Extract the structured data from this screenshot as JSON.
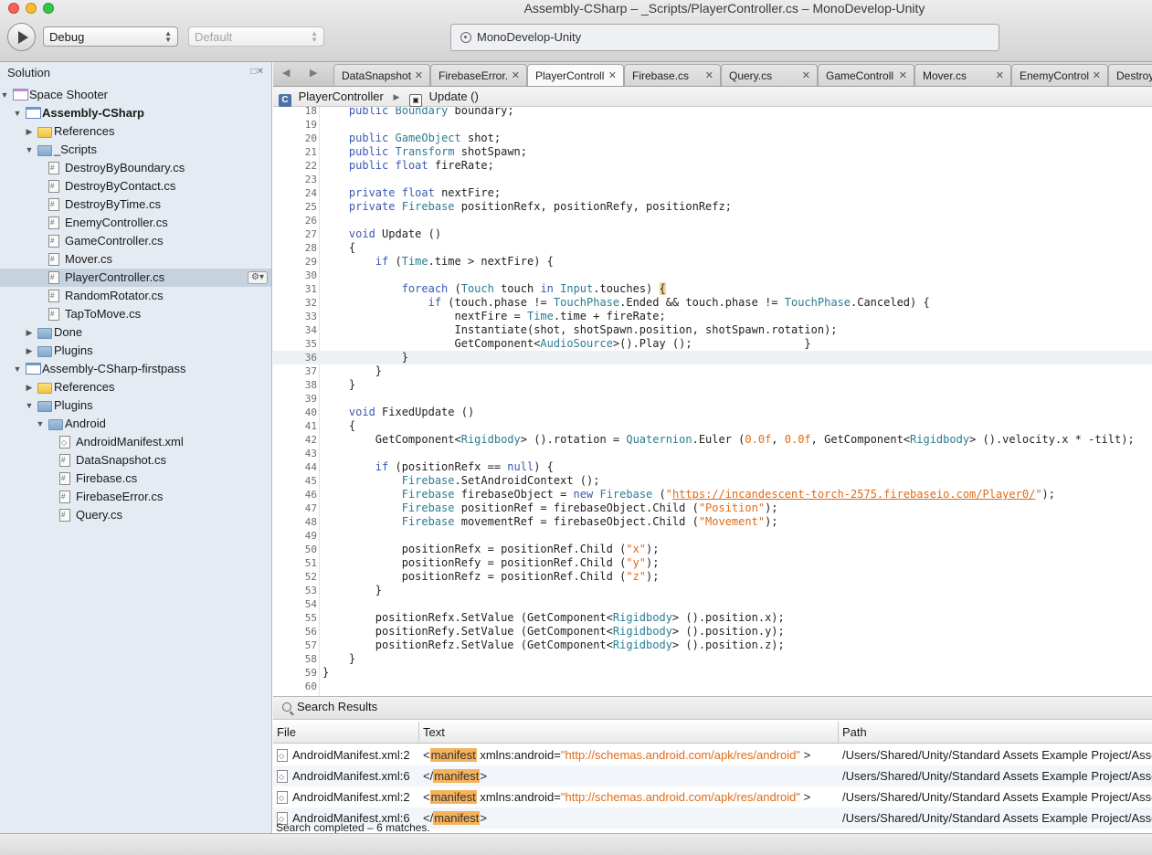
{
  "window": {
    "title": "Assembly-CSharp – _Scripts/PlayerController.cs – MonoDevelop-Unity"
  },
  "toolbar": {
    "config": "Debug",
    "platform": "Default",
    "status": "MonoDevelop-Unity"
  },
  "sidebar": {
    "title": "Solution",
    "items": [
      {
        "label": "Space Shooter",
        "icon": "solution-icon",
        "depth": 0,
        "expander": "down"
      },
      {
        "label": "Assembly-CSharp",
        "icon": "project-icon",
        "depth": 1,
        "expander": "down",
        "bold": true
      },
      {
        "label": "References",
        "icon": "folder-yellow-icon",
        "depth": 2,
        "expander": "right"
      },
      {
        "label": "_Scripts",
        "icon": "folder-icon",
        "depth": 2,
        "expander": "down"
      },
      {
        "label": "DestroyByBoundary.cs",
        "icon": "file-icon",
        "depth": 3
      },
      {
        "label": "DestroyByContact.cs",
        "icon": "file-icon",
        "depth": 3
      },
      {
        "label": "DestroyByTime.cs",
        "icon": "file-icon",
        "depth": 3
      },
      {
        "label": "EnemyController.cs",
        "icon": "file-icon",
        "depth": 3
      },
      {
        "label": "GameController.cs",
        "icon": "file-icon",
        "depth": 3
      },
      {
        "label": "Mover.cs",
        "icon": "file-icon",
        "depth": 3
      },
      {
        "label": "PlayerController.cs",
        "icon": "file-icon",
        "depth": 3,
        "selected": true
      },
      {
        "label": "RandomRotator.cs",
        "icon": "file-icon",
        "depth": 3
      },
      {
        "label": "TapToMove.cs",
        "icon": "file-icon",
        "depth": 3
      },
      {
        "label": "Done",
        "icon": "folder-icon",
        "depth": 2,
        "expander": "right"
      },
      {
        "label": "Plugins",
        "icon": "folder-icon",
        "depth": 2,
        "expander": "right"
      },
      {
        "label": "Assembly-CSharp-firstpass",
        "icon": "project-icon",
        "depth": 1,
        "expander": "down"
      },
      {
        "label": "References",
        "icon": "folder-yellow-icon",
        "depth": 2,
        "expander": "right"
      },
      {
        "label": "Plugins",
        "icon": "folder-icon",
        "depth": 2,
        "expander": "down"
      },
      {
        "label": "Android",
        "icon": "folder-icon",
        "depth": 3,
        "expander": "down"
      },
      {
        "label": "AndroidManifest.xml",
        "icon": "xml-file-icon",
        "depth": 4
      },
      {
        "label": "DataSnapshot.cs",
        "icon": "file-icon",
        "depth": 4
      },
      {
        "label": "Firebase.cs",
        "icon": "file-icon",
        "depth": 4
      },
      {
        "label": "FirebaseError.cs",
        "icon": "file-icon",
        "depth": 4
      },
      {
        "label": "Query.cs",
        "icon": "file-icon",
        "depth": 4
      }
    ]
  },
  "tabs": [
    {
      "label": "DataSnapshot"
    },
    {
      "label": "FirebaseError."
    },
    {
      "label": "PlayerControll",
      "active": true
    },
    {
      "label": "Firebase.cs"
    },
    {
      "label": "Query.cs"
    },
    {
      "label": "GameControll"
    },
    {
      "label": "Mover.cs"
    },
    {
      "label": "EnemyControl"
    },
    {
      "label": "Destroy"
    }
  ],
  "breadcrumb": {
    "class": "PlayerController",
    "method": "Update ()"
  },
  "editor": {
    "current_line": 36,
    "lines": [
      {
        "n": 18,
        "html": "    <span class=\"kw\">public</span> <span class=\"tp\">Boundary</span> boundary;"
      },
      {
        "n": 19,
        "html": ""
      },
      {
        "n": 20,
        "html": "    <span class=\"kw\">public</span> <span class=\"tp\">GameObject</span> shot;"
      },
      {
        "n": 21,
        "html": "    <span class=\"kw\">public</span> <span class=\"tp\">Transform</span> shotSpawn;"
      },
      {
        "n": 22,
        "html": "    <span class=\"kw\">public</span> <span class=\"kw\">float</span> fireRate;"
      },
      {
        "n": 23,
        "html": ""
      },
      {
        "n": 24,
        "html": "    <span class=\"kw\">private</span> <span class=\"kw\">float</span> nextFire;"
      },
      {
        "n": 25,
        "html": "    <span class=\"kw\">private</span> <span class=\"tp\">Firebase</span> positionRefx, positionRefy, positionRefz;"
      },
      {
        "n": 26,
        "html": ""
      },
      {
        "n": 27,
        "html": "    <span class=\"kw\">void</span> Update ()"
      },
      {
        "n": 28,
        "html": "    {"
      },
      {
        "n": 29,
        "html": "        <span class=\"kw\">if</span> (<span class=\"tp\">Time</span>.time &gt; nextFire) {"
      },
      {
        "n": 30,
        "html": ""
      },
      {
        "n": 31,
        "html": "            <span class=\"kw\">foreach</span> (<span class=\"tp\">Touch</span> touch <span class=\"kw\">in</span> <span class=\"tp\">Input</span>.touches) <span class=\"brace-hl\">{</span>"
      },
      {
        "n": 32,
        "html": "                <span class=\"kw\">if</span> (touch.phase != <span class=\"tp\">TouchPhase</span>.Ended &amp;&amp; touch.phase != <span class=\"tp\">TouchPhase</span>.Canceled) {"
      },
      {
        "n": 33,
        "html": "                    nextFire = <span class=\"tp\">Time</span>.time + fireRate;"
      },
      {
        "n": 34,
        "html": "                    Instantiate(shot, shotSpawn.position, shotSpawn.rotation);"
      },
      {
        "n": 35,
        "html": "                    GetComponent&lt;<span class=\"tp\">AudioSource</span>&gt;().Play ();                 }"
      },
      {
        "n": 36,
        "html": "            }"
      },
      {
        "n": 37,
        "html": "        }"
      },
      {
        "n": 38,
        "html": "    }"
      },
      {
        "n": 39,
        "html": ""
      },
      {
        "n": 40,
        "html": "    <span class=\"kw\">void</span> FixedUpdate ()"
      },
      {
        "n": 41,
        "html": "    {"
      },
      {
        "n": 42,
        "html": "        GetComponent&lt;<span class=\"tp\">Rigidbody</span>&gt; ().rotation = <span class=\"tp\">Quaternion</span>.Euler (<span class=\"str\">0.0f</span>, <span class=\"str\">0.0f</span>, GetComponent&lt;<span class=\"tp\">Rigidbody</span>&gt; ().velocity.x * -tilt);"
      },
      {
        "n": 43,
        "html": ""
      },
      {
        "n": 44,
        "html": "        <span class=\"kw\">if</span> (positionRefx == <span class=\"kw\">null</span>) {"
      },
      {
        "n": 45,
        "html": "            <span class=\"tp\">Firebase</span>.SetAndroidContext ();"
      },
      {
        "n": 46,
        "html": "            <span class=\"tp\">Firebase</span> firebaseObject = <span class=\"kw\">new</span> <span class=\"tp\">Firebase</span> (<span class=\"str\">\"</span><span class=\"url\">https://incandescent-torch-2575.firebaseio.com/Player0/</span><span class=\"str\">\"</span>);"
      },
      {
        "n": 47,
        "html": "            <span class=\"tp\">Firebase</span> positionRef = firebaseObject.Child (<span class=\"str\">\"Position\"</span>);"
      },
      {
        "n": 48,
        "html": "            <span class=\"tp\">Firebase</span> movementRef = firebaseObject.Child (<span class=\"str\">\"Movement\"</span>);"
      },
      {
        "n": 49,
        "html": ""
      },
      {
        "n": 50,
        "html": "            positionRefx = positionRef.Child (<span class=\"str\">\"x\"</span>);"
      },
      {
        "n": 51,
        "html": "            positionRefy = positionRef.Child (<span class=\"str\">\"y\"</span>);"
      },
      {
        "n": 52,
        "html": "            positionRefz = positionRef.Child (<span class=\"str\">\"z\"</span>);"
      },
      {
        "n": 53,
        "html": "        }"
      },
      {
        "n": 54,
        "html": ""
      },
      {
        "n": 55,
        "html": "        positionRefx.SetValue (GetComponent&lt;<span class=\"tp\">Rigidbody</span>&gt; ().position.x);"
      },
      {
        "n": 56,
        "html": "        positionRefy.SetValue (GetComponent&lt;<span class=\"tp\">Rigidbody</span>&gt; ().position.y);"
      },
      {
        "n": 57,
        "html": "        positionRefz.SetValue (GetComponent&lt;<span class=\"tp\">Rigidbody</span>&gt; ().position.z);"
      },
      {
        "n": 58,
        "html": "    }"
      },
      {
        "n": 59,
        "html": "}"
      },
      {
        "n": 60,
        "html": ""
      }
    ]
  },
  "search_results": {
    "title": "Search Results",
    "columns": [
      "File",
      "Text",
      "Path"
    ],
    "rows": [
      {
        "file": "AndroidManifest.xml:2",
        "pre": "<",
        "hit": "manifest",
        "mid": " xmlns:android=",
        "str": "\"http://schemas.android.com/apk/res/android\"",
        "post": " >",
        "path": "/Users/Shared/Unity/Standard Assets Example Project/Assets/Plugins/Android/AndroidManifest.xml"
      },
      {
        "file": "AndroidManifest.xml:6",
        "pre": "</",
        "hit": "manifest",
        "mid": ">",
        "str": "",
        "post": "",
        "path": "/Users/Shared/Unity/Standard Assets Example Project/Assets/Plugins/Android/AndroidManifest.xml"
      },
      {
        "file": "AndroidManifest.xml:2",
        "pre": "<",
        "hit": "manifest",
        "mid": " xmlns:android=",
        "str": "\"http://schemas.android.com/apk/res/android\"",
        "post": " >",
        "path": "/Users/Shared/Unity/Standard Assets Example Project/Assets/Plugins/Android/AndroidManifest.xml"
      },
      {
        "file": "AndroidManifest.xml:6",
        "pre": "</",
        "hit": "manifest",
        "mid": ">",
        "str": "",
        "post": "",
        "path": "/Users/Shared/Unity/Standard Assets Example Project/Assets/Plugins/Android/AndroidManifest.xml"
      }
    ],
    "status": "Search completed – 6 matches."
  }
}
